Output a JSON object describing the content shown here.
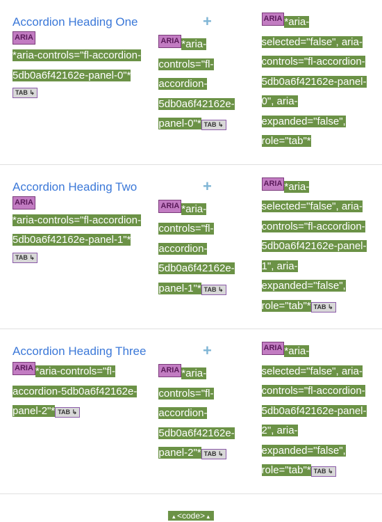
{
  "badges": {
    "aria": "ARIA",
    "tab": "TAB"
  },
  "plus": "+",
  "code_label": "<code>",
  "rows": [
    {
      "heading": "Accordion Heading One",
      "left_attr": "*aria-controls=\"fl-accordion-5db0a6f42162e-panel-0\"*",
      "mid_attr": "*aria-controls=\"fl-accordion-5db0a6f42162e-panel-0\"*",
      "right_attr": "*aria-selected=\"false\", aria-controls=\"fl-accordion-5db0a6f42162e-panel-0\", aria-expanded=\"false\", role=\"tab\"*"
    },
    {
      "heading": "Accordion Heading Two",
      "left_attr": "*aria-controls=\"fl-accordion-5db0a6f42162e-panel-1\"*",
      "mid_attr": "*aria-controls=\"fl-accordion-5db0a6f42162e-panel-1\"*",
      "right_attr": "*aria-selected=\"false\", aria-controls=\"fl-accordion-5db0a6f42162e-panel-1\", aria-expanded=\"false\", role=\"tab\"*"
    },
    {
      "heading": "Accordion Heading Three",
      "left_attr": "*aria-controls=\"fl-accordion-5db0a6f42162e-panel-2\"*",
      "mid_attr": "*aria-controls=\"fl-accordion-5db0a6f42162e-panel-2\"*",
      "right_attr": "*aria-selected=\"false\", aria-controls=\"fl-accordion-5db0a6f42162e-panel-2\", aria-expanded=\"false\", role=\"tab\"*"
    }
  ]
}
